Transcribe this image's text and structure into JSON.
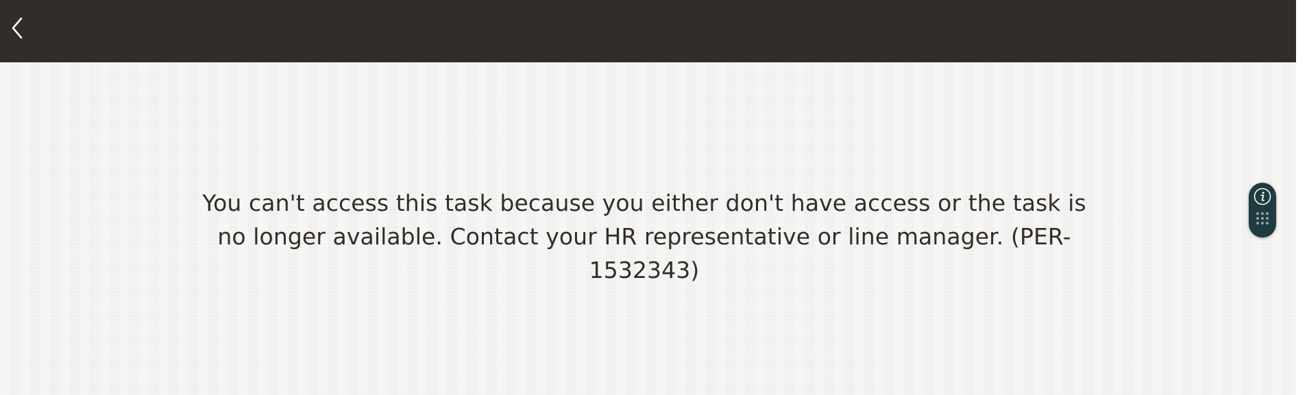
{
  "header": {
    "back_icon": "chevron-left-icon",
    "background_color": "#312d2a"
  },
  "message": {
    "text": "You can't access this task because you either don't have access or the task is no longer available. Contact your HR representative or line manager. (PER-1532343)"
  },
  "help_widget": {
    "info_icon": "info-icon",
    "grip_icon": "drag-grip-icon",
    "background_color": "#1f3b3f"
  }
}
